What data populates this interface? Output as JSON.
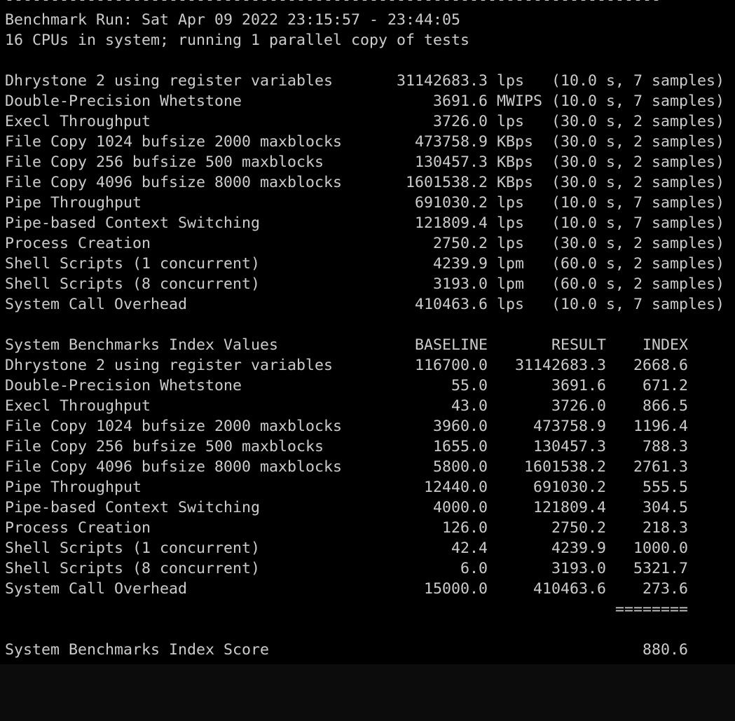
{
  "terminal": {
    "separator": "------------------------------------------------------------------------",
    "run_line": "Benchmark Run: Sat Apr 09 2022 23:15:57 - 23:44:05",
    "cpu_line": "16 CPUs in system; running 1 parallel copy of tests",
    "results": [
      {
        "name": "Dhrystone 2 using register variables",
        "value": "31142683.3",
        "unit": "lps",
        "detail": "(10.0 s, 7 samples)"
      },
      {
        "name": "Double-Precision Whetstone",
        "value": "3691.6",
        "unit": "MWIPS",
        "detail": "(10.0 s, 7 samples)"
      },
      {
        "name": "Execl Throughput",
        "value": "3726.0",
        "unit": "lps",
        "detail": "(30.0 s, 2 samples)"
      },
      {
        "name": "File Copy 1024 bufsize 2000 maxblocks",
        "value": "473758.9",
        "unit": "KBps",
        "detail": "(30.0 s, 2 samples)"
      },
      {
        "name": "File Copy 256 bufsize 500 maxblocks",
        "value": "130457.3",
        "unit": "KBps",
        "detail": "(30.0 s, 2 samples)"
      },
      {
        "name": "File Copy 4096 bufsize 8000 maxblocks",
        "value": "1601538.2",
        "unit": "KBps",
        "detail": "(30.0 s, 2 samples)"
      },
      {
        "name": "Pipe Throughput",
        "value": "691030.2",
        "unit": "lps",
        "detail": "(10.0 s, 7 samples)"
      },
      {
        "name": "Pipe-based Context Switching",
        "value": "121809.4",
        "unit": "lps",
        "detail": "(10.0 s, 7 samples)"
      },
      {
        "name": "Process Creation",
        "value": "2750.2",
        "unit": "lps",
        "detail": "(30.0 s, 2 samples)"
      },
      {
        "name": "Shell Scripts (1 concurrent)",
        "value": "4239.9",
        "unit": "lpm",
        "detail": "(60.0 s, 2 samples)"
      },
      {
        "name": "Shell Scripts (8 concurrent)",
        "value": "3193.0",
        "unit": "lpm",
        "detail": "(60.0 s, 2 samples)"
      },
      {
        "name": "System Call Overhead",
        "value": "410463.6",
        "unit": "lps",
        "detail": "(10.0 s, 7 samples)"
      }
    ],
    "index_table": {
      "title": "System Benchmarks Index Values",
      "headers": [
        "BASELINE",
        "RESULT",
        "INDEX"
      ],
      "rows": [
        {
          "name": "Dhrystone 2 using register variables",
          "baseline": "116700.0",
          "result": "31142683.3",
          "index": "2668.6"
        },
        {
          "name": "Double-Precision Whetstone",
          "baseline": "55.0",
          "result": "3691.6",
          "index": "671.2"
        },
        {
          "name": "Execl Throughput",
          "baseline": "43.0",
          "result": "3726.0",
          "index": "866.5"
        },
        {
          "name": "File Copy 1024 bufsize 2000 maxblocks",
          "baseline": "3960.0",
          "result": "473758.9",
          "index": "1196.4"
        },
        {
          "name": "File Copy 256 bufsize 500 maxblocks",
          "baseline": "1655.0",
          "result": "130457.3",
          "index": "788.3"
        },
        {
          "name": "File Copy 4096 bufsize 8000 maxblocks",
          "baseline": "5800.0",
          "result": "1601538.2",
          "index": "2761.3"
        },
        {
          "name": "Pipe Throughput",
          "baseline": "12440.0",
          "result": "691030.2",
          "index": "555.5"
        },
        {
          "name": "Pipe-based Context Switching",
          "baseline": "4000.0",
          "result": "121809.4",
          "index": "304.5"
        },
        {
          "name": "Process Creation",
          "baseline": "126.0",
          "result": "2750.2",
          "index": "218.3"
        },
        {
          "name": "Shell Scripts (1 concurrent)",
          "baseline": "42.4",
          "result": "4239.9",
          "index": "1000.0"
        },
        {
          "name": "Shell Scripts (8 concurrent)",
          "baseline": "6.0",
          "result": "3193.0",
          "index": "5321.7"
        },
        {
          "name": "System Call Overhead",
          "baseline": "15000.0",
          "result": "410463.6",
          "index": "273.6"
        }
      ],
      "total_rule": "========",
      "score_label": "System Benchmarks Index Score",
      "score_value": "880.6"
    }
  }
}
